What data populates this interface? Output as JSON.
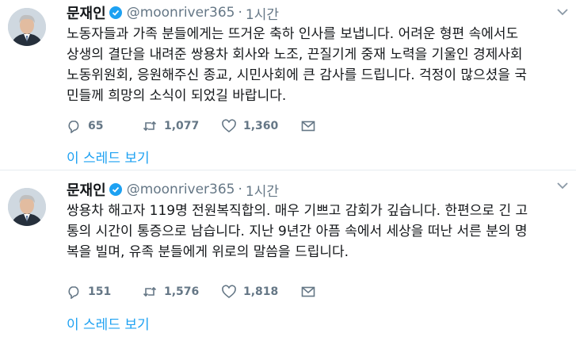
{
  "tweets": [
    {
      "name": "문재인",
      "handle": "@moonriver365",
      "dot": "·",
      "time": "1시간",
      "text": "노동자들과 가족 분들에게는 뜨거운 축하 인사를 보냅니다. 어려운 형편 속에서도\n상생의 결단을 내려준 쌍용차 회사와 노조, 끈질기게 중재 노력을 기울인 경제사회\n노동위원회, 응원해주신 종교, 시민사회에 큰 감사를 드립니다. 걱정이 많으셨을 국\n민들께 희망의 소식이 되었길 바랍니다.",
      "replies": "65",
      "retweets": "1,077",
      "likes": "1,360",
      "thread_label": "이 스레드 보기"
    },
    {
      "name": "문재인",
      "handle": "@moonriver365",
      "dot": "·",
      "time": "1시간",
      "text": "쌍용차 해고자 119명 전원복직합의. 매우 기쁘고 감회가 깊습니다. 한편으로 긴 고\n통의 시간이 통증으로 남습니다. 지난 9년간 아픔 속에서 세상을 떠난 서른 분의 명\n복을 빌며, 유족 분들에게 위로의 말씀을 드립니다.",
      "replies": "151",
      "retweets": "1,576",
      "likes": "1,818",
      "thread_label": "이 스레드 보기"
    }
  ],
  "icons": {
    "verified": "verified-badge-icon",
    "reply": "reply-icon",
    "retweet": "retweet-icon",
    "like": "heart-icon",
    "message": "direct-message-icon",
    "more": "chevron-down-icon"
  },
  "colors": {
    "accent": "#1da1f2",
    "muted": "#657786",
    "text": "#14171a"
  }
}
